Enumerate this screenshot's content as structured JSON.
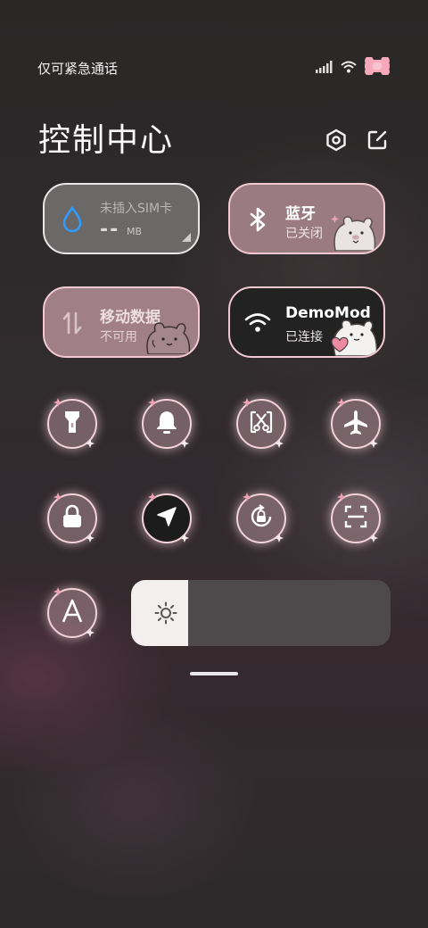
{
  "status": {
    "carrier_text": "仅可紧急通话",
    "icons": [
      "signal-icon",
      "wifi-icon",
      "battery-icon"
    ]
  },
  "header": {
    "title": "控制中心",
    "actions": [
      "settings-icon",
      "edit-icon"
    ]
  },
  "tiles": {
    "sim": {
      "title": "未插入SIM卡",
      "value": "--",
      "unit": "MB",
      "icon": "water-drop-icon"
    },
    "bluetooth": {
      "title": "蓝牙",
      "status": "已关闭",
      "icon": "bluetooth-icon"
    },
    "mobile_data": {
      "title": "移动数据",
      "status": "不可用",
      "icon": "data-arrows-icon"
    },
    "wifi": {
      "title": "DemoMod",
      "status": "已连接",
      "icon": "wifi-icon"
    }
  },
  "toggles": [
    {
      "name": "flashlight",
      "icon": "flashlight-icon",
      "active": false
    },
    {
      "name": "ringer",
      "icon": "bell-icon",
      "active": false
    },
    {
      "name": "screenshot",
      "icon": "scissors-icon",
      "active": false
    },
    {
      "name": "airplane",
      "icon": "airplane-icon",
      "active": false
    },
    {
      "name": "lock",
      "icon": "lock-icon",
      "active": false
    },
    {
      "name": "location",
      "icon": "location-arrow-icon",
      "active": true
    },
    {
      "name": "rotation-lock",
      "icon": "rotation-lock-icon",
      "active": false
    },
    {
      "name": "scanner",
      "icon": "scan-icon",
      "active": false
    },
    {
      "name": "auto-brightness",
      "icon": "letter-a-icon",
      "active": false
    }
  ],
  "brightness": {
    "level": 0.22,
    "icon": "sun-icon"
  },
  "colors": {
    "accent_pink": "#f2c9d2",
    "tile_pink": "#9a7b82",
    "tile_gray": "#6b6868",
    "tile_dark": "#232223",
    "sim_icon_blue": "#2f9bff"
  }
}
